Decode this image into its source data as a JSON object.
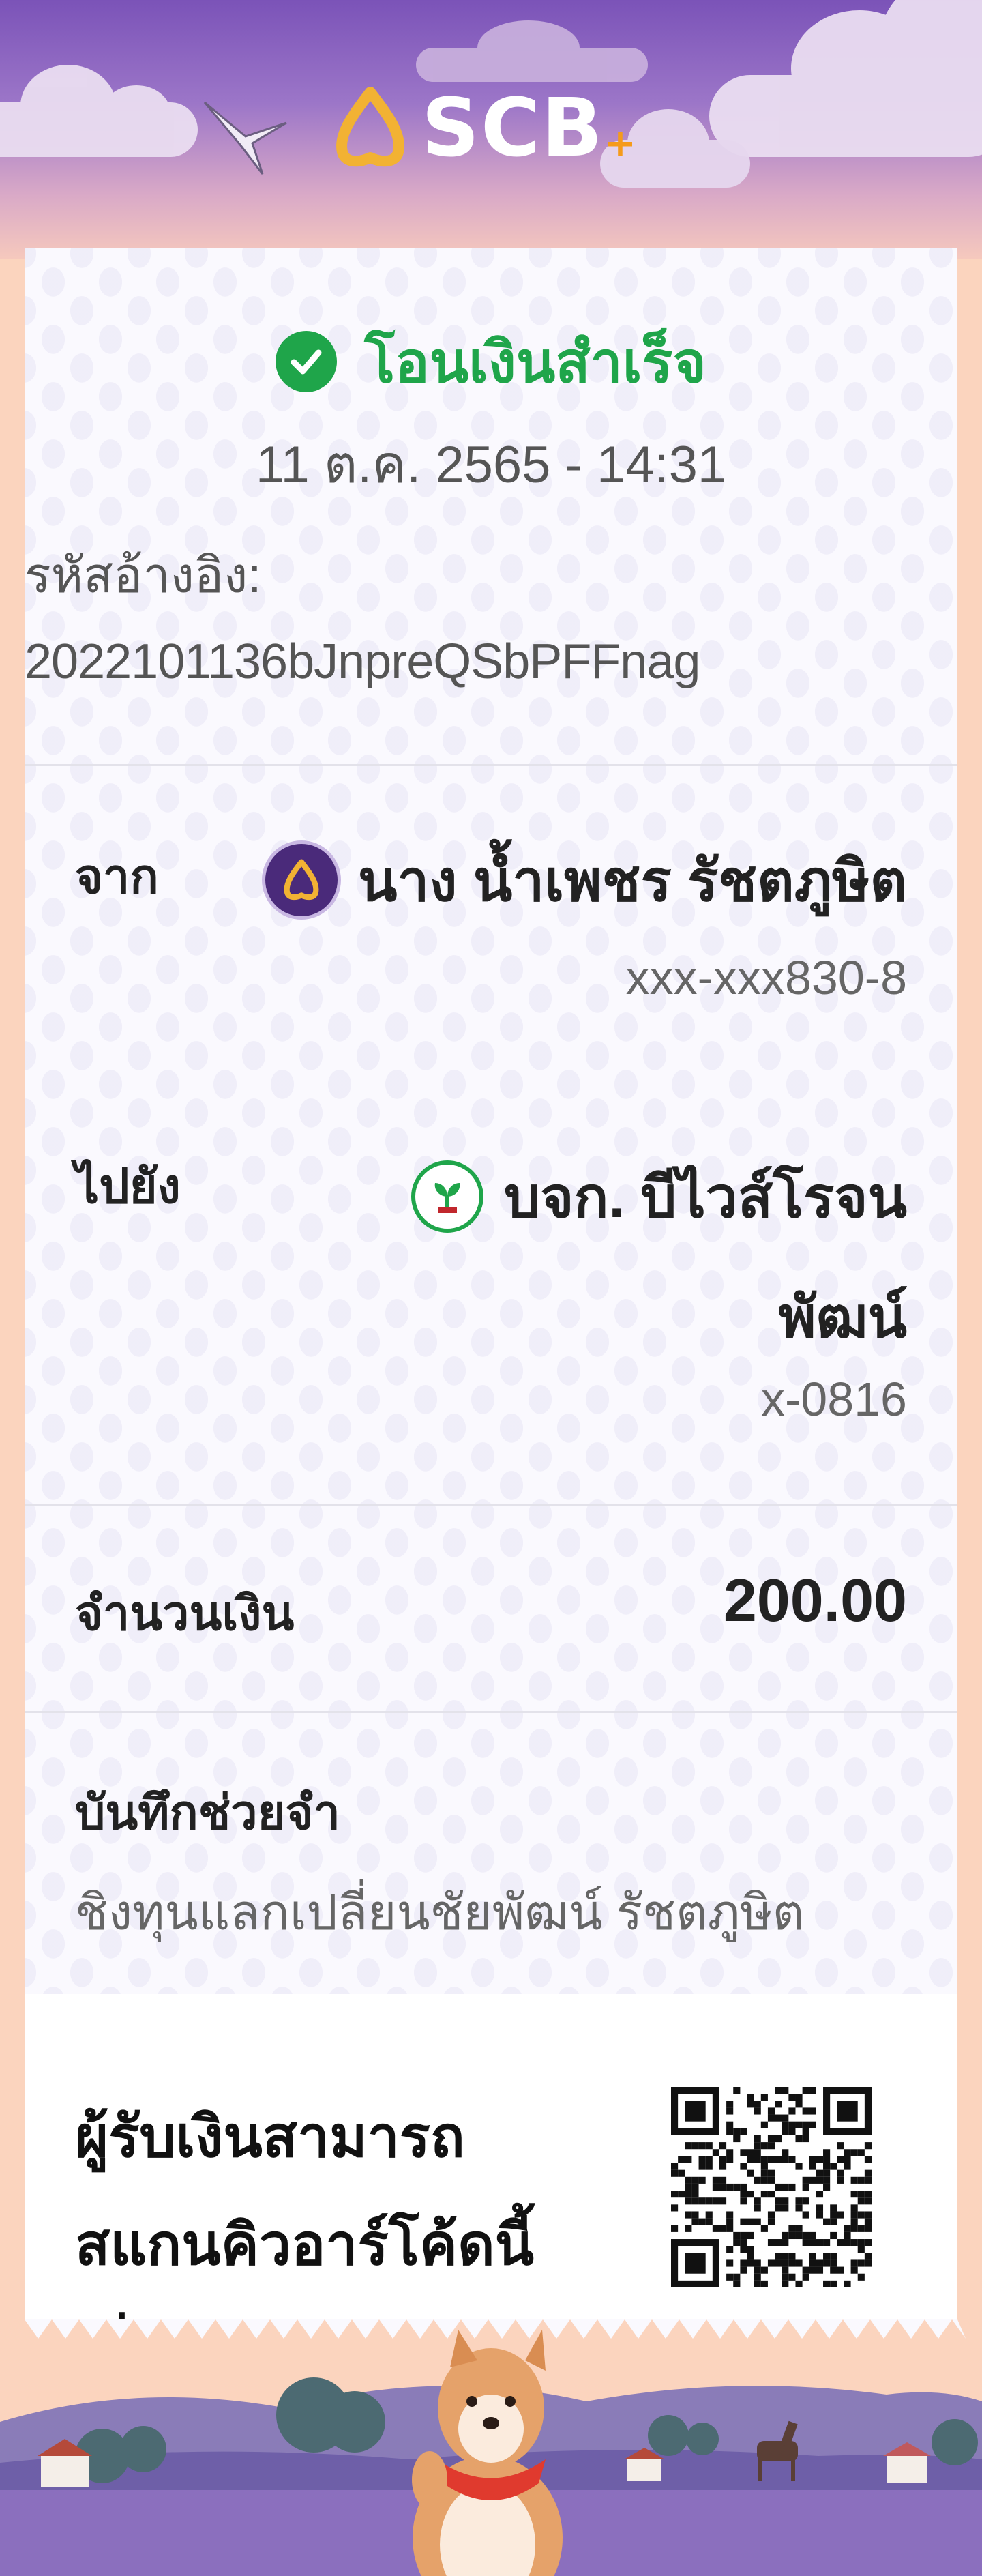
{
  "brand": {
    "name": "SCB",
    "plus": "+"
  },
  "receipt": {
    "status": "โอนเงินสำเร็จ",
    "datetime": "11 ต.ค. 2565 - 14:31",
    "ref_label": "รหัสอ้างอิง:",
    "ref_value": "2022101136bJnpreQSbPFFnag",
    "from": {
      "label": "จาก",
      "name": "นาง น้ำเพชร รัชตภูษิต",
      "account": "xxx-xxx830-8"
    },
    "to": {
      "label": "ไปยัง",
      "name_line1": "บจก. บีไวส์โรจน",
      "name_line2": "พัฒน์",
      "account": "x-0816"
    },
    "amount": {
      "label": "จำนวนเงิน",
      "value": "200.00"
    },
    "memo": {
      "label": "บันทึกช่วยจำ",
      "value": "ชิงทุนแลกเปลี่ยนชัยพัฒน์ รัชตภูษิต"
    },
    "qr_note": [
      "ผู้รับเงินสามารถ",
      "สแกนคิวอาร์โค้ดนี้",
      "เพื่อตรวจสอบสถาน"
    ]
  },
  "colors": {
    "success": "#1FA54A",
    "brand_purple": "#4A2A7A",
    "background": "#FBD4BE"
  },
  "icons": {
    "status": "check-circle-icon",
    "from_bank": "scb-bank-icon",
    "to_bank": "kbank-icon",
    "qr": "qr-code-icon"
  }
}
